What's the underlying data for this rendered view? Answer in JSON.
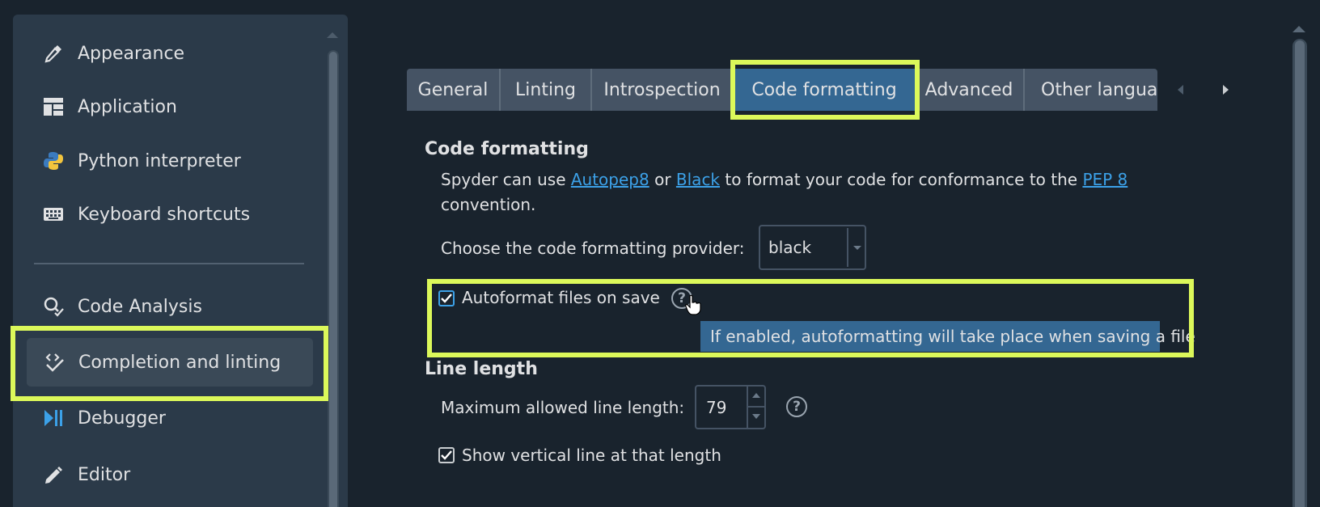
{
  "sidebar": {
    "items": [
      {
        "label": "Appearance",
        "icon": "pipette-icon"
      },
      {
        "label": "Application",
        "icon": "app-layout-icon"
      },
      {
        "label": "Python interpreter",
        "icon": "python-icon"
      },
      {
        "label": "Keyboard shortcuts",
        "icon": "keyboard-icon"
      },
      {
        "label": "Code Analysis",
        "icon": "code-analysis-icon"
      },
      {
        "label": "Completion and linting",
        "icon": "completion-icon",
        "selected": true
      },
      {
        "label": "Debugger",
        "icon": "debugger-icon"
      },
      {
        "label": "Editor",
        "icon": "pencil-icon"
      }
    ]
  },
  "tabs": [
    {
      "label": "General"
    },
    {
      "label": "Linting"
    },
    {
      "label": "Introspection"
    },
    {
      "label": "Code formatting",
      "active": true
    },
    {
      "label": "Advanced"
    },
    {
      "label": "Other languag"
    }
  ],
  "code_formatting": {
    "title": "Code formatting",
    "desc_pre": "Spyder can use ",
    "link_autopep8": "Autopep8",
    "desc_or": " or ",
    "link_black": "Black",
    "desc_mid": " to format your code for conformance to the ",
    "link_pep8": "PEP 8",
    "desc_post": "convention.",
    "provider_label": "Choose the code formatting provider:",
    "provider_value": "black",
    "autoformat_label": "Autoformat files on save",
    "autoformat_checked": true,
    "tooltip": "If enabled, autoformatting will take place when saving a file"
  },
  "line_length": {
    "title": "Line length",
    "max_label": "Maximum allowed line length:",
    "max_value": "79",
    "show_vline_label": "Show vertical line at that length",
    "show_vline_checked": true
  },
  "colors": {
    "background": "#19232d",
    "panel": "#2b3a49",
    "accent": "#346792",
    "link": "#3ca1e8",
    "highlight": "#dcf85a"
  }
}
